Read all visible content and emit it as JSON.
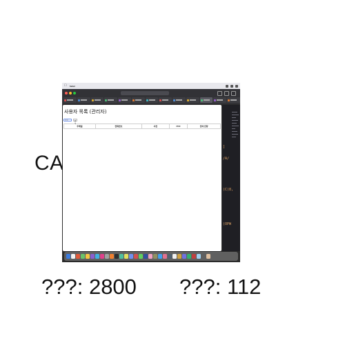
{
  "overlay": {
    "ca_text": "CA",
    "bottom_left": "???: 2800",
    "bottom_right": "???: 112"
  },
  "menubar": {
    "app_name": "Safari"
  },
  "browser": {
    "tab_count": 13
  },
  "page": {
    "title": "사용자 목록 (관리자)",
    "search": {
      "placeholder": "검색",
      "button_label": "검색"
    },
    "table": {
      "columns": [
        "주메일",
        "전화번호",
        "사진",
        "PDF",
        "잔여 잔량"
      ]
    }
  },
  "code_panel": {
    "lines": [
      "]",
      "/A/",
      "(C)8,",
      "",
      "",
      "(OPW"
    ]
  },
  "colors": {
    "accent": "#6a8ee8",
    "traffic_red": "#ff5f57",
    "traffic_yellow": "#febc2e",
    "traffic_green": "#28c840"
  }
}
